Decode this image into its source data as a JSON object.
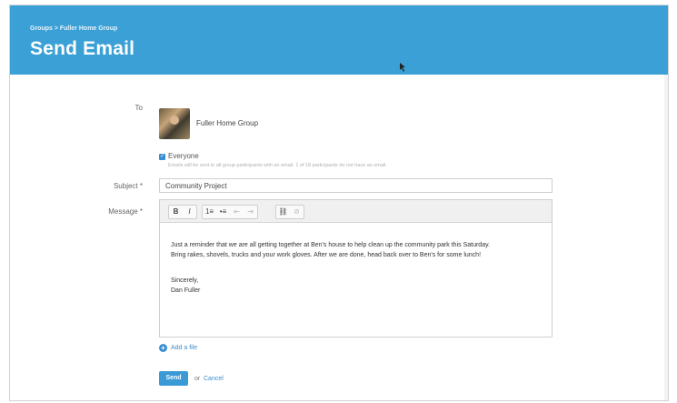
{
  "header": {
    "breadcrumb": "Groups > Fuller Home Group",
    "title": "Send Email",
    "background_color": "#3aa0d6"
  },
  "form": {
    "to_label": "To",
    "group_name": "Fuller Home Group",
    "everyone_label": "Everyone",
    "everyone_checked": true,
    "everyone_note": "Emails will be sent to all group participants with an email. 1 of 18 participants do not have an email.",
    "subject_label": "Subject *",
    "subject_value": "Community Project",
    "message_label": "Message *",
    "toolbar": [
      "B",
      "I",
      "1≡",
      "•≡",
      "⇤",
      "⇥",
      "⛓",
      "⊘"
    ],
    "message_lines": [
      "Just a reminder that we are all getting together at Ben's house to help clean up the community park this Saturday.",
      "Bring rakes, shovels, trucks and your work gloves.  After we are done, head back over to Ben's for some lunch!",
      "",
      "Sincerely,",
      "Dan Fuller"
    ],
    "add_file_label": "Add a file",
    "send_label": "Send",
    "or_label": "or",
    "cancel_label": "Cancel"
  }
}
